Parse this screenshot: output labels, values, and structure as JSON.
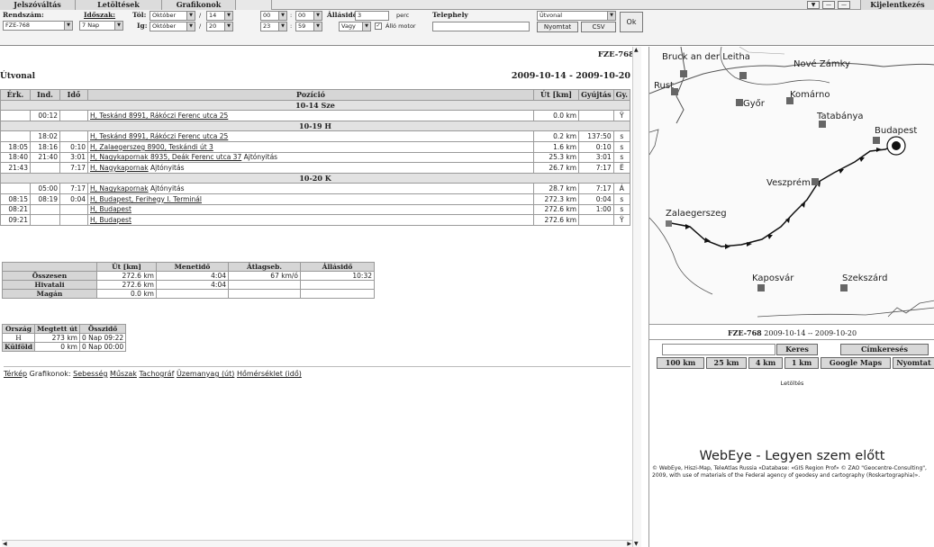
{
  "topbar": {
    "tabs": [
      "Jelszóváltás",
      "Letöltések",
      "Grafikonok"
    ],
    "window_buttons": [
      "▼",
      "—",
      "—"
    ],
    "logout": "Kijelentkezés"
  },
  "filter": {
    "plate_label": "Rendszám:",
    "plate_value": "FZE-768",
    "period_label": "Időszak:",
    "period_value": "7 Nap",
    "from_label": "Tól:",
    "from_month": "Október",
    "from_day": "14",
    "from_hour": "00",
    "from_minute": "00",
    "to_label": "Ig:",
    "to_month": "Október",
    "to_day": "20",
    "to_hour": "23",
    "to_minute": "59",
    "slash": "/",
    "colon": ":",
    "stop_label": "Állásidő:",
    "stop_value": "3",
    "stop_unit": "perc",
    "or_value": "Vagy",
    "engine_check": "✓",
    "engine_label": "Álló motor",
    "site_label": "Telephely",
    "view_value": "Útvonal",
    "print_button": "Nyomtat",
    "csv_button": "CSV",
    "ok_button": "Ok"
  },
  "report": {
    "vehicle_id": "FZE-768",
    "title": "Útvonal",
    "date_range": "2009-10-14 - 2009-10-20",
    "headers": [
      "Érk.",
      "Ind.",
      "Idő",
      "Pozíció",
      "Út [km]",
      "Gyújtás",
      "Gy."
    ],
    "rows": [
      {
        "type": "day",
        "label": "10-14 Sze"
      },
      {
        "type": "trip",
        "arr": "",
        "dep": "00:12",
        "dur": "",
        "pos": "H, Teskánd 8991, Rákóczi Ferenc utca 25",
        "pos_suffix": "",
        "km": "0.0 km",
        "ign": "",
        "gy": "Ÿ"
      },
      {
        "type": "day",
        "label": "10-19 H"
      },
      {
        "type": "trip",
        "arr": "",
        "dep": "18:02",
        "dur": "",
        "pos": "H, Teskánd 8991, Rákóczi Ferenc utca 25",
        "pos_suffix": "",
        "km": "0.2 km",
        "ign": "137:50",
        "gy": "s"
      },
      {
        "type": "trip",
        "arr": "18:05",
        "dep": "18:16",
        "dur": "0:10",
        "pos": "H, Zalaegerszeg 8900, Teskándi út 3",
        "pos_suffix": "",
        "km": "1.6 km",
        "ign": "0:10",
        "gy": "s"
      },
      {
        "type": "trip",
        "arr": "18:40",
        "dep": "21:40",
        "dur": "3:01",
        "pos": "H, Nagykapornak 8935, Deák Ferenc utca 37",
        "pos_suffix": " Ajtónyitás",
        "km": "25.3 km",
        "ign": "3:01",
        "gy": "s"
      },
      {
        "type": "trip",
        "arr": "21:43",
        "dep": "",
        "dur": "7:17",
        "pos": "H, Nagykapornak",
        "pos_suffix": " Ajtónyitás",
        "km": "26.7 km",
        "ign": "7:17",
        "gy": "Ë"
      },
      {
        "type": "day",
        "label": "10-20 K"
      },
      {
        "type": "trip",
        "arr": "",
        "dep": "05:00",
        "dur": "7:17",
        "pos": "H, Nagykapornak",
        "pos_suffix": " Ajtónyitás",
        "km": "28.7 km",
        "ign": "7:17",
        "gy": "Á"
      },
      {
        "type": "trip",
        "arr": "08:15",
        "dep": "08:19",
        "dur": "0:04",
        "pos": "H, Budapest, Ferihegy I. Terminál",
        "pos_suffix": "",
        "km": "272.3 km",
        "ign": "0:04",
        "gy": "s"
      },
      {
        "type": "trip",
        "arr": "08:21",
        "dep": "",
        "dur": "",
        "pos": "H, Budapest",
        "pos_suffix": "",
        "km": "272.6 km",
        "ign": "1:00",
        "gy": "s"
      },
      {
        "type": "trip",
        "arr": "09:21",
        "dep": "",
        "dur": "",
        "pos": "H, Budapest",
        "pos_suffix": "",
        "km": "272.6 km",
        "ign": "",
        "gy": "Ÿ"
      }
    ]
  },
  "summary": {
    "headers": [
      "",
      "Út [km]",
      "Menetidő",
      "Átlagseb.",
      "Állásidő"
    ],
    "rows": [
      [
        "Összesen",
        "272.6 km",
        "4:04",
        "67 km/ó",
        "10:32"
      ],
      [
        "Hivatali",
        "272.6 km",
        "4:04",
        "",
        ""
      ],
      [
        "Magán",
        "0.0 km",
        "",
        "",
        ""
      ]
    ]
  },
  "country": {
    "headers": [
      "Ország",
      "Megtett út",
      "Összidő"
    ],
    "rows": [
      [
        "H",
        "273 km",
        "0 Nap 09:22"
      ],
      [
        "Külföld",
        "0 km",
        "0 Nap 00:00"
      ]
    ]
  },
  "links": {
    "map": "Térkép",
    "charts_label": "Grafikonok:",
    "charts": [
      "Sebesség",
      "Műszak",
      "Tachográf",
      "Üzemanyag (út)",
      "Hőmérséklet (idő)"
    ]
  },
  "map": {
    "cities": [
      "Bruck an der Leitha",
      "Nové Zámky",
      "Rust",
      "Győr",
      "Komárno",
      "Tatabánya",
      "Budapest",
      "Veszprém",
      "Zalaegerszeg",
      "Kaposvár",
      "Szekszárd"
    ],
    "footer_vehicle": "FZE-768",
    "footer_dates": "2009-10-14 -- 2009-10-20",
    "search_button": "Keres",
    "tag_search_button": "Címkeresés",
    "scale_buttons": [
      "100 km",
      "25 km",
      "4 km",
      "1 km",
      "Google Maps",
      "Nyomtat"
    ],
    "download": "Letöltés",
    "slogan": "WebEye - Legyen szem előtt",
    "credits": "© WebEye, Hiszi-Map, TeleAtlas Russia «Database: «GIS Region Prof» © ZAO \"Geocentre-Consulting\", 2009, with use of materials of the Federal agency of geodesy and cartography (Roskartographia)»."
  }
}
